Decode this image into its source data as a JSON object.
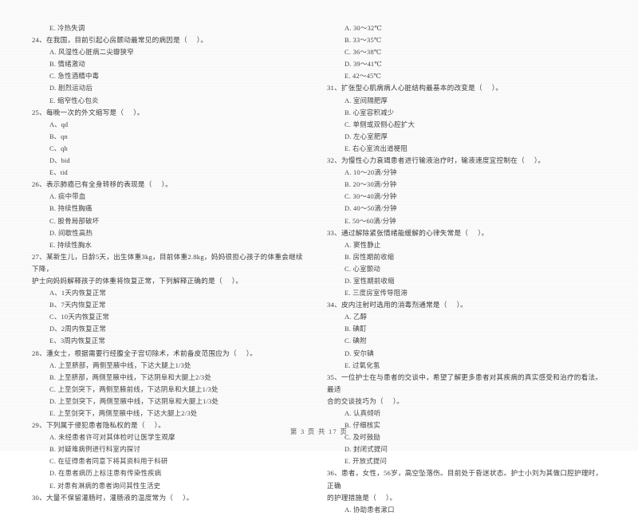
{
  "document": {
    "type": "scanned-exam-paper",
    "language": "zh-CN",
    "footer": "第 3 页 共 17 页"
  },
  "left_column": {
    "orphan_option": "E. 冷热失调",
    "questions": [
      {
        "stem": "24、在我国，目前引起心房颤动最常见的病因是（     ）。",
        "options": [
          "A. 风湿性心脏病二尖瓣狭窄",
          "B. 情绪激动",
          "C. 急性酒精中毒",
          "D. 剧烈运动后",
          "E. 缩窄性心包炎"
        ]
      },
      {
        "stem": "25、每晚一次的外文缩写是（     ）。",
        "options": [
          "A、qd",
          "B、qn",
          "C、qh",
          "D、bid",
          "E、tid"
        ]
      },
      {
        "stem": "26、表示肺癌已有全身转移的表现是（     ）。",
        "options": [
          "A. 痰中带血",
          "B. 持续性胸痛",
          "C. 股骨局部破坏",
          "D. 间歇性高热",
          "E. 持续性胸水"
        ]
      },
      {
        "stem": "27、某新生儿，日龄5天，出生体重3kg，目前体重2.8kg，妈妈很担心孩子的体重会继续下降，",
        "stem_line2": "护士向妈妈解释孩子的体重将恢复正常，下列解释正确的是（     ）。",
        "options": [
          "A、1天内恢复正常",
          "B、7天内恢复正常",
          "C、10天内恢复正常",
          "D、2周内恢复正常",
          "E、3周内恢复正常"
        ]
      },
      {
        "stem": "28、潘女士，根据需要行经腹全子宫切除术，术前备皮范围应为（     ）。",
        "options": [
          "A. 上至脐部，两侧至腋中线，下达大腿上1/3处",
          "B. 上至脐部，两侧至腋中线，下达阴阜和大腿上2/3处",
          "C. 上至剑突下，两侧至腋前线，下达阴阜和大腿上1/3处",
          "D. 上至剑突下，两侧至腋中线，下达阴阜和大腿上1/3处",
          "E. 上至剑突下，两侧至腋中线，下达大腿上2/3处"
        ]
      },
      {
        "stem": "29、下列属于侵犯患者隐私权的是（     ）。",
        "options": [
          "A. 未经患者许可对其体检时让医学生观摩",
          "B. 对疑难病例进行科室内探讨",
          "C. 在征得患者同意下将其资料用于科研",
          "D. 在患者病历上标注患有传染性疾病",
          "E. 对患有淋病的患者询问其性生活史"
        ]
      },
      {
        "stem": "30、大量不保留灌肠时，灌肠液的温度常为（     ）。",
        "options": []
      }
    ]
  },
  "right_column": {
    "orphan_options": [
      "A. 30～32℃",
      "B. 33～35℃",
      "C. 36～38℃",
      "D. 39～41℃",
      "E. 42～45℃"
    ],
    "questions": [
      {
        "stem": "31、扩张型心肌病病人心脏结构最基本的改变是（     ）。",
        "options": [
          "A. 室间隔肥厚",
          "B. 心室容积减少",
          "C. 单侧或双侧心腔扩大",
          "D. 左心室肥厚",
          "E. 右心室流出道梗阻"
        ]
      },
      {
        "stem": "32、为慢性心力衰竭患者进行输液治疗时，输液速度宜控制在（     ）。",
        "options": [
          "A. 10～20滴/分钟",
          "B. 20～30滴/分钟",
          "C. 30～40滴/分钟",
          "D. 40～50滴/分钟",
          "E. 50～60滴/分钟"
        ]
      },
      {
        "stem": "33、通过解除紧张情绪能缓解的心律失常是（     ）。",
        "options": [
          "A. 窦性静止",
          "B. 房性期前收缩",
          "C. 心室颤动",
          "D. 室性期前收缩",
          "E. 三度房室传导阻滞"
        ]
      },
      {
        "stem": "34、皮内注射时选用的消毒剂通常是（     ）。",
        "options": [
          "A. 乙醇",
          "B. 碘酊",
          "C. 碘附",
          "D. 安尔碘",
          "E. 过氧化氢"
        ]
      },
      {
        "stem": "35、一位护士在与患者的交谈中，希望了解更多患者对其疾病的真实感受和治疗的看法。最适",
        "stem_line2": "合的交谈技巧为（     ）。",
        "options": [
          "A. 认真倾听",
          "B. 仔细核实",
          "C. 及时鼓励",
          "D. 封闭式提问",
          "E. 开放式提问"
        ]
      },
      {
        "stem": "36、患者，女性，56岁，高空坠落伤。目前处于昏迷状态。护士小刘为其做口腔护理时，正确",
        "stem_line2": "的护理措施是（     ）。",
        "options": [
          "A. 协助患者漱口"
        ]
      }
    ]
  }
}
